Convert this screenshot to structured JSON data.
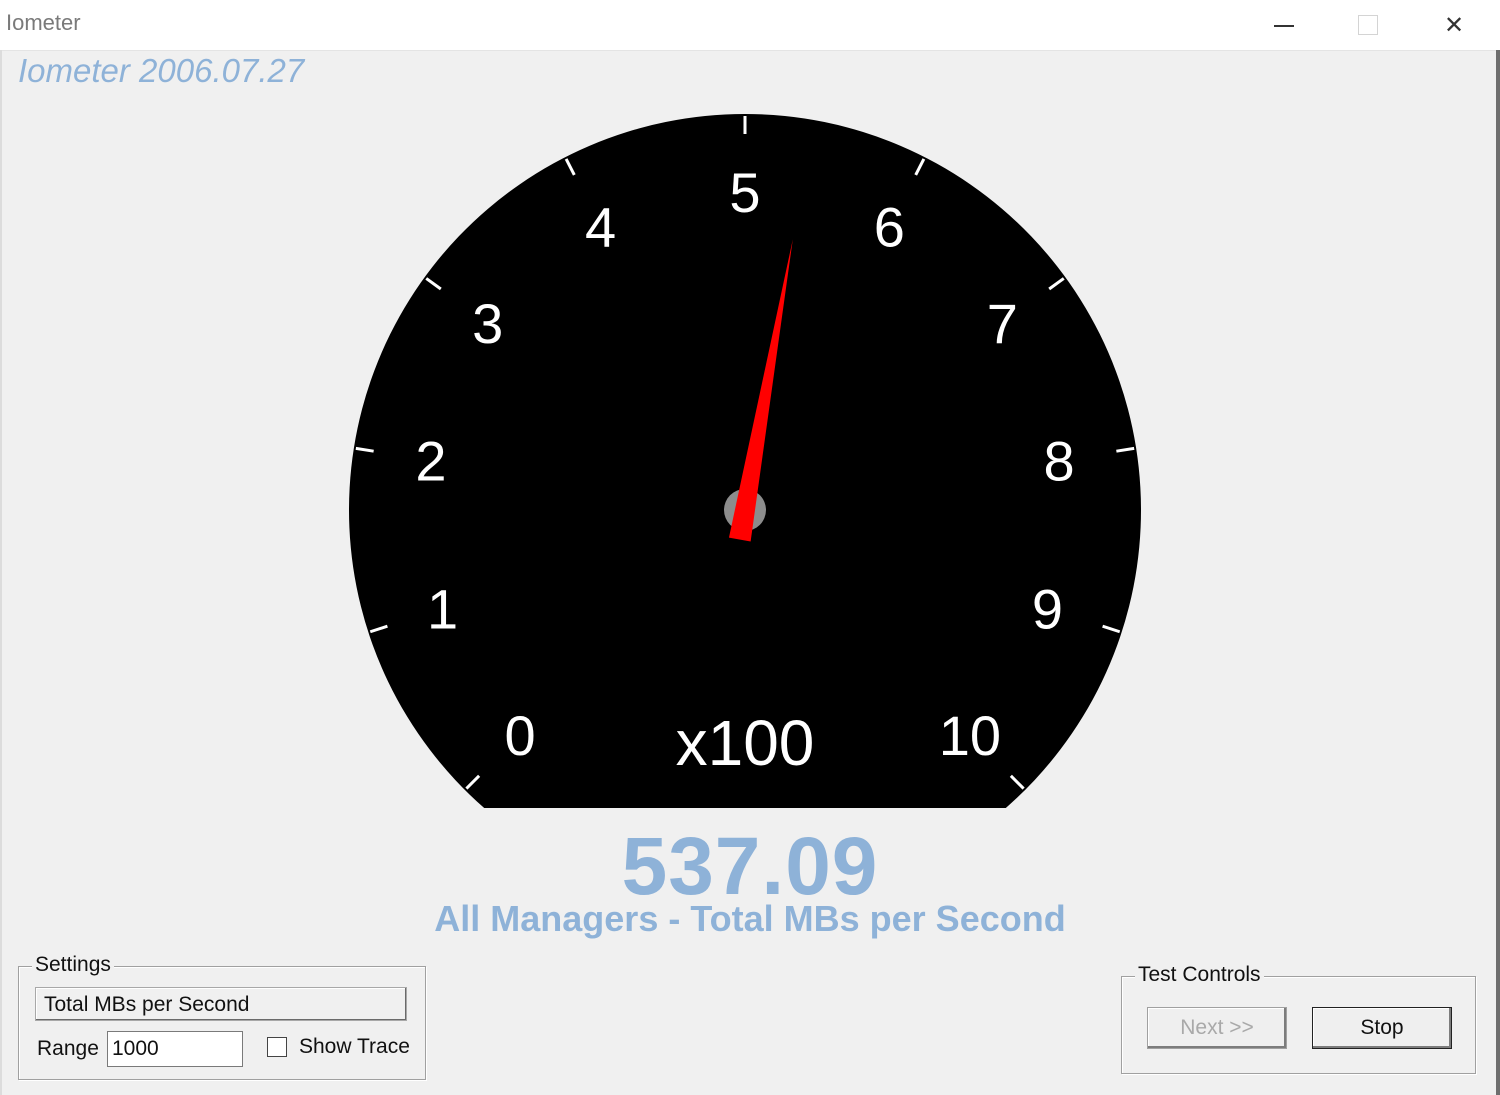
{
  "window": {
    "title": "Iometer",
    "controls": {
      "minimize_icon": "minimize-icon",
      "maximize_icon": "maximize-icon",
      "close_icon": "close-icon"
    }
  },
  "app": {
    "title": "Iometer 2006.07.27"
  },
  "gauge": {
    "labels": [
      "0",
      "1",
      "2",
      "3",
      "4",
      "5",
      "6",
      "7",
      "8",
      "9",
      "10"
    ],
    "multiplier": "x100",
    "min": 0,
    "max": 10,
    "needle_value": 5.3709,
    "colors": {
      "face": "#000000",
      "needle": "#ff0000",
      "hub": "#8c8c8c",
      "text": "#ffffff"
    }
  },
  "readout": {
    "value": "537.09",
    "caption": "All Managers - Total MBs per Second",
    "color": "#8eb2d8"
  },
  "settings": {
    "legend": "Settings",
    "metric_selected": "Total MBs per Second",
    "range_label": "Range",
    "range_value": "1000",
    "show_trace_label": "Show Trace",
    "show_trace_checked": false
  },
  "test_controls": {
    "legend": "Test Controls",
    "next_label": "Next >>",
    "next_enabled": false,
    "stop_label": "Stop"
  }
}
